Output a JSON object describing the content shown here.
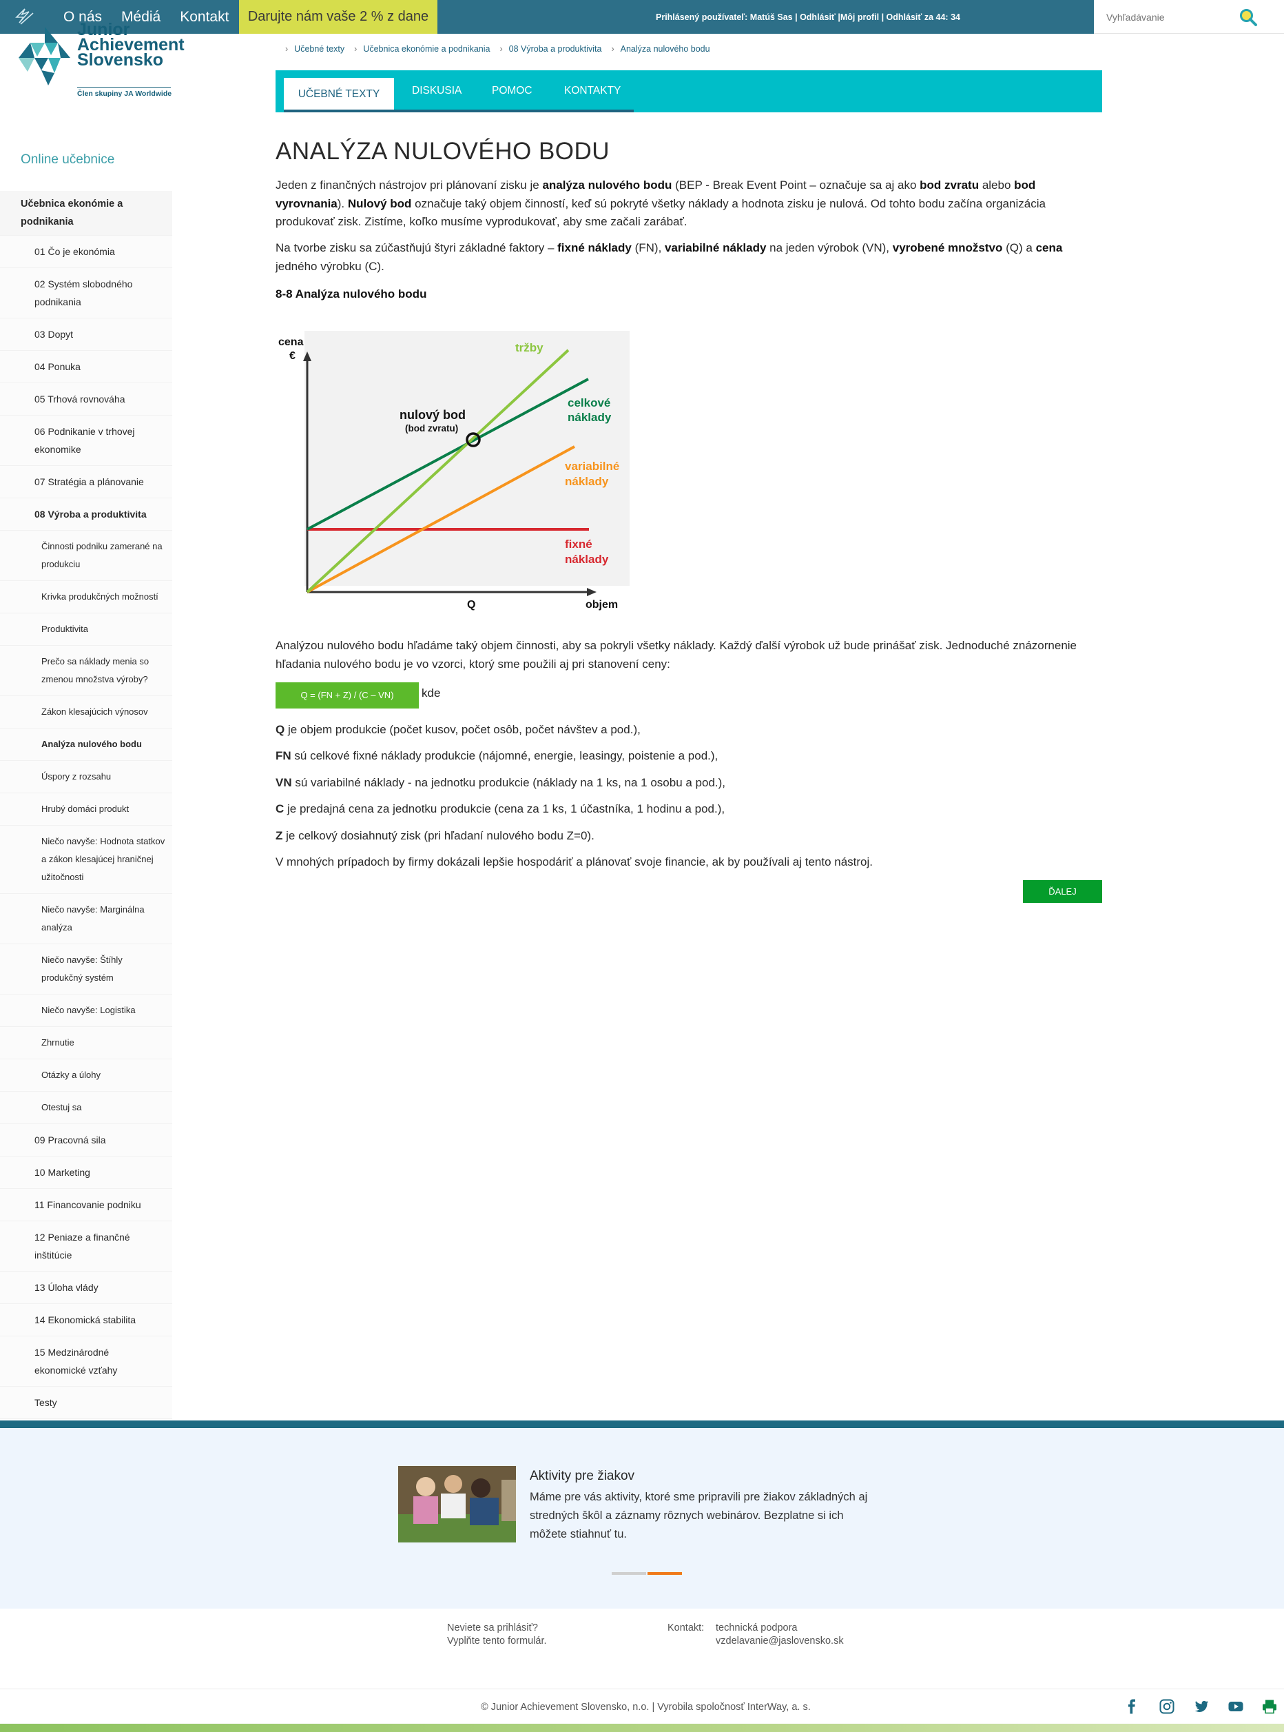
{
  "topbar": {
    "nav": [
      "O nás",
      "Médiá",
      "Kontakt"
    ],
    "donate": "Darujte nám vaše 2 % z dane",
    "user_text": "Prihlásený používateľ: Matúš Sas | Odhlásiť |Môj profil | Odhlásiť za 44: 34",
    "search_placeholder": "Vyhľadávanie"
  },
  "brand": {
    "line1": "Junior",
    "line2": "Achievement",
    "line3": "Slovensko",
    "subline": "Člen skupiny JA Worldwide"
  },
  "sidebar": {
    "online": "Online učebnice",
    "book": "Učebnica ekonómie a podnikania",
    "chapters_before": [
      "01 Čo je ekonómia",
      "02 Systém slobodného podnikania",
      "03 Dopyt",
      "04 Ponuka",
      "05 Trhová rovnováha",
      "06 Podnikanie v trhovej ekonomike",
      "07 Stratégia a plánovanie"
    ],
    "current_chapter": "08 Výroba a produktivita",
    "subitems": [
      "Činnosti podniku zamerané na produkciu",
      "Krivka produkčných možností",
      "Produktivita",
      "Prečo sa náklady menia so zmenou množstva výroby?",
      "Zákon klesajúcich výnosov",
      "Analýza nulového bodu",
      "Úspory z rozsahu",
      "Hrubý domáci produkt",
      "Niečo navyše: Hodnota statkov a zákon klesajúcej hraničnej užitočnosti",
      "Niečo navyše: Marginálna analýza",
      "Niečo navyše: Štíhly produkčný systém",
      "Niečo navyše: Logistika",
      "Zhrnutie",
      "Otázky a úlohy",
      "Otestuj sa"
    ],
    "chapters_after": [
      "09 Pracovná sila",
      "10 Marketing",
      "11 Financovanie podniku",
      "12 Peniaze a finančné inštitúcie",
      "13 Úloha vlády",
      "14 Ekonomická stabilita",
      "15 Medzinárodné ekonomické vzťahy"
    ],
    "tests": "Testy"
  },
  "breadcrumb": [
    "Učebné texty",
    "Učebnica ekonómie a podnikania",
    "08 Výroba a produktivita",
    "Analýza nulového bodu"
  ],
  "tabs": [
    "UČEBNÉ TEXTY",
    "DISKUSIA",
    "POMOC",
    "KONTAKTY"
  ],
  "content": {
    "title": "ANALÝZA NULOVÉHO BODU",
    "p1": {
      "a": "Jeden z finančných nástrojov pri plánovaní zisku je ",
      "b": "analýza nulového bodu",
      "c": " (BEP - Break Event Point – označuje sa aj ako ",
      "d": "bod zvratu",
      "e": " alebo ",
      "f": "bod vyrovnania",
      "g": "). ",
      "h": "Nulový bod",
      "i": " označuje taký objem činností, keď sú pokryté všetky náklady a hodnota zisku je nulová. Od tohto bodu začína organizácia produkovať zisk. Zistíme, koľko musíme vyprodukovať, aby sme začali zarábať."
    },
    "p2": {
      "a": "Na tvorbe zisku sa zúčastňujú štyri základné faktory – ",
      "b": "fixné náklady",
      "c": " (FN), ",
      "d": "variabilné náklady",
      "e": " na jeden výrobok (VN), ",
      "f": "vyrobené množstvo",
      "g": " (Q) a ",
      "h": "cena",
      "i": " jedného výrobku (C)."
    },
    "figure_caption": "8-8 Analýza nulového bodu",
    "p3": "Analýzou nulového bodu hľadáme taký objem činnosti, aby sa pokryli všetky náklady. Každý ďalší výrobok už bude prinášať zisk. Jednoduché znázornenie hľadania nulového bodu je vo vzorci, ktorý sme použili aj pri stanovení ceny:",
    "formula": "Q = (FN + Z) / (C – VN)",
    "kde": "kde",
    "defs": [
      {
        "k": "Q",
        "v": " je objem produkcie (počet kusov, počet osôb, počet návštev a pod.),"
      },
      {
        "k": "FN",
        "v": " sú celkové fixné náklady produkcie (nájomné, energie, leasingy, poistenie a pod.),"
      },
      {
        "k": "VN",
        "v": " sú variabilné náklady - na jednotku produkcie (náklady na 1 ks, na 1 osobu a pod.),"
      },
      {
        "k": "C",
        "v": " je predajná cena za jednotku produkcie (cena za 1 ks, 1 účastníka, 1 hodinu a pod.),"
      },
      {
        "k": "Z",
        "v": " je celkový dosiahnutý zisk (pri hľadaní nulového bodu Z=0)."
      }
    ],
    "p4": "V mnohých prípadoch by firmy dokázali lepšie hospodáriť a plánovať svoje financie, ak by používali aj tento nástroj.",
    "next": "ĎALEJ"
  },
  "chart": {
    "ylabel1": "cena",
    "ylabel2": "€",
    "xlabel": "objem",
    "q_label": "Q",
    "bep1": "nulový bod",
    "bep2": "(bod zvratu)",
    "trzby": "tržby",
    "celk1": "celkové",
    "celk2": "náklady",
    "var1": "variabilné",
    "var2": "náklady",
    "fix1": "fixné",
    "fix2": "náklady",
    "colors": {
      "trzby": "#8cc63f",
      "celkove": "#0a7f4a",
      "variabilne": "#f7941d",
      "fixne": "#d7282f"
    }
  },
  "footer": {
    "title": "Aktivity pre žiakov",
    "text": "Máme pre vás aktivity, ktoré sme pripravili pre žiakov základných aj stredných škôl a záznamy rôznych webinárov. Bezplatne si ich môžete stiahnuť tu.",
    "login1": "Neviete sa prihlásiť?",
    "login2": "Vyplňte tento formulár.",
    "contact_label": "Kontakt:",
    "contact1": "technická podpora",
    "contact2": "vzdelavanie@jaslovensko.sk",
    "copyright": "© Junior Achievement Slovensko, n.o. | Vyrobila spoločnosť InterWay, a. s."
  }
}
